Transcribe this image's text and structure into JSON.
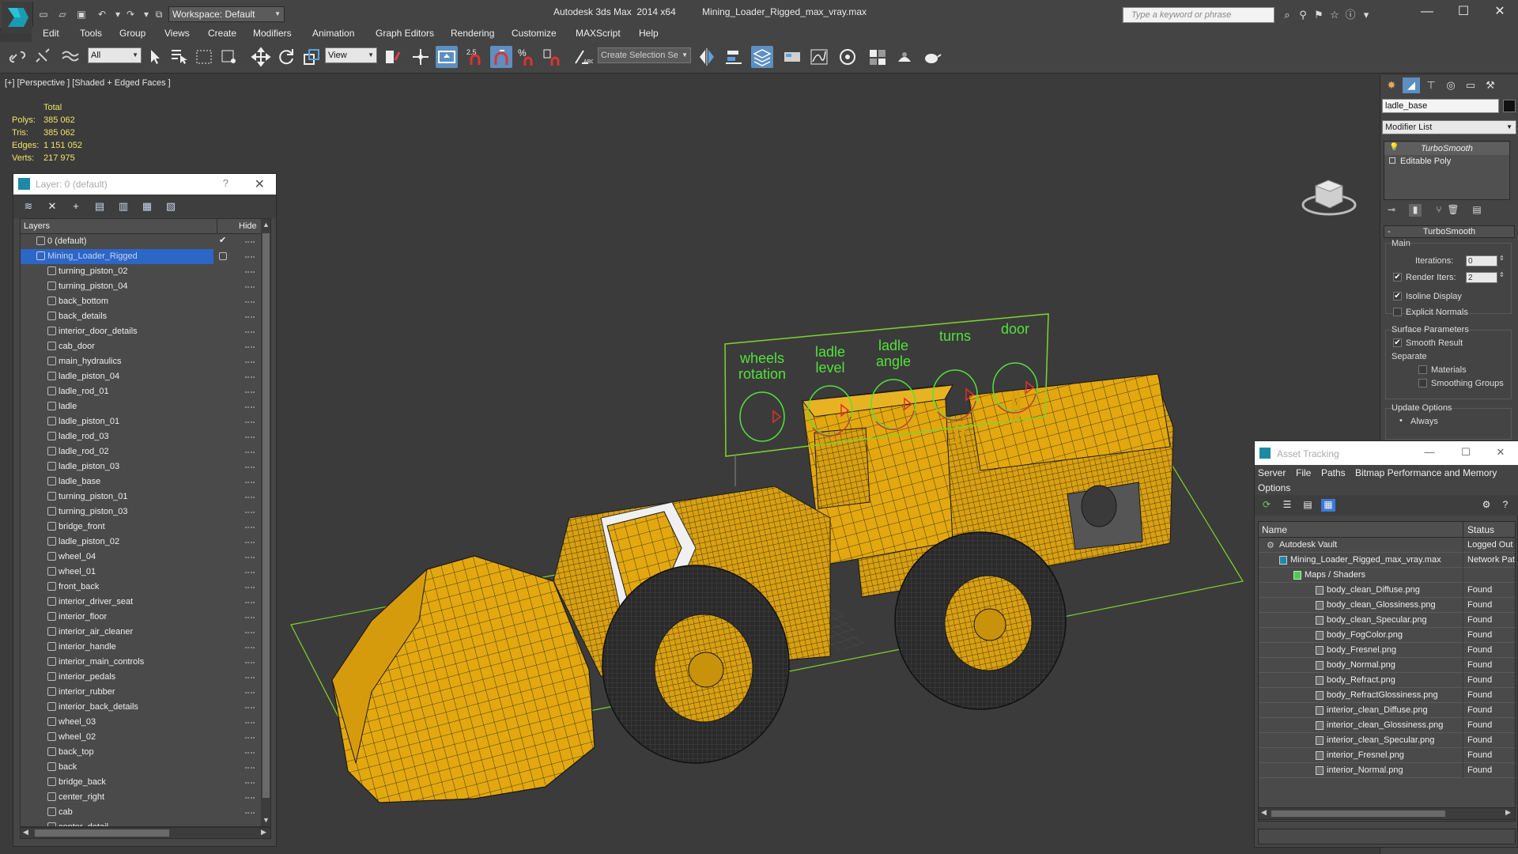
{
  "app": {
    "title": "Autodesk 3ds Max  2014 x64",
    "file": "Mining_Loader_Rigged_max_vray.max",
    "workspace": "Workspace: Default",
    "search_placeholder": "Type a keyword or phrase"
  },
  "menu": [
    "Edit",
    "Tools",
    "Group",
    "Views",
    "Create",
    "Modifiers",
    "Animation",
    "Graph Editors",
    "Rendering",
    "Customize",
    "MAXScript",
    "Help"
  ],
  "toolbar": {
    "filter": "All",
    "ref_coord": "View",
    "snap_label": "2.5",
    "selection_set_placeholder": "Create Selection Se"
  },
  "viewport": {
    "label": "[+] [Perspective ] [Shaded + Edged Faces ]",
    "stats": {
      "header": "Total",
      "polys_label": "Polys:",
      "polys": "385 062",
      "tris_label": "Tris:",
      "tris": "385 062",
      "edges_label": "Edges:",
      "edges": "1 151 052",
      "verts_label": "Verts:",
      "verts": "217 975"
    },
    "control_panel": {
      "labels": [
        {
          "l1": "wheels",
          "l2": "rotation"
        },
        {
          "l1": "ladle",
          "l2": "level"
        },
        {
          "l1": "ladle",
          "l2": "angle"
        },
        {
          "l1": "turns",
          "l2": ""
        },
        {
          "l1": "door",
          "l2": ""
        }
      ]
    },
    "colors": {
      "model": "#e3a80f",
      "wire": "#1a1a1a",
      "selection": "#7ed52a",
      "gizmo_text": "#52e23a",
      "gizmo_arrow": "#e03030"
    }
  },
  "layer_panel": {
    "title": "Layer: 0 (default)",
    "col_layers": "Layers",
    "col_hide": "Hide",
    "default_layer": "0 (default)",
    "selected_layer": "Mining_Loader_Rigged",
    "objects": [
      "turning_piston_02",
      "turning_piston_04",
      "back_bottom",
      "back_details",
      "interior_door_details",
      "cab_door",
      "main_hydraulics",
      "ladle_piston_04",
      "ladle_rod_01",
      "ladle",
      "ladle_piston_01",
      "ladle_rod_03",
      "ladle_rod_02",
      "ladle_piston_03",
      "ladle_base",
      "turning_piston_01",
      "turning_piston_03",
      "bridge_front",
      "ladle_piston_02",
      "wheel_04",
      "wheel_01",
      "front_back",
      "interior_driver_seat",
      "interior_floor",
      "interior_air_cleaner",
      "interior_handle",
      "interior_main_controls",
      "interior_pedals",
      "interior_rubber",
      "interior_back_details",
      "wheel_03",
      "wheel_02",
      "back_top",
      "back",
      "bridge_back",
      "center_right",
      "cab",
      "center_detail"
    ]
  },
  "command_panel": {
    "object_name": "ladle_base",
    "modifier_list": "Modifier List",
    "stack": [
      "TurboSmooth",
      "Editable Poly"
    ],
    "rollout_title": "TurboSmooth",
    "main_label": "Main",
    "iterations_label": "Iterations:",
    "iterations": "0",
    "render_iters_label": "Render Iters:",
    "render_iters": "2",
    "isoline": "Isoline Display",
    "explicit_normals": "Explicit Normals",
    "surface_params": "Surface Parameters",
    "smooth_result": "Smooth Result",
    "separate": "Separate",
    "materials": "Materials",
    "smoothing_groups": "Smoothing Groups",
    "update_options": "Update Options",
    "always": "Always"
  },
  "asset_tracking": {
    "title": "Asset Tracking",
    "menu": [
      "Server",
      "File",
      "Paths",
      "Bitmap Performance and Memory",
      "Options"
    ],
    "col_name": "Name",
    "col_status": "Status",
    "vault": {
      "name": "Autodesk Vault",
      "status": "Logged Out"
    },
    "file": {
      "name": "Mining_Loader_Rigged_max_vray.max",
      "status": "Network Pat"
    },
    "maps": "Maps / Shaders",
    "files": [
      {
        "name": "body_clean_Diffuse.png",
        "status": "Found"
      },
      {
        "name": "body_clean_Glossiness.png",
        "status": "Found"
      },
      {
        "name": "body_clean_Specular.png",
        "status": "Found"
      },
      {
        "name": "body_FogColor.png",
        "status": "Found"
      },
      {
        "name": "body_Fresnel.png",
        "status": "Found"
      },
      {
        "name": "body_Normal.png",
        "status": "Found"
      },
      {
        "name": "body_Refract.png",
        "status": "Found"
      },
      {
        "name": "body_RefractGlossiness.png",
        "status": "Found"
      },
      {
        "name": "interior_clean_Diffuse.png",
        "status": "Found"
      },
      {
        "name": "interior_clean_Glossiness.png",
        "status": "Found"
      },
      {
        "name": "interior_clean_Specular.png",
        "status": "Found"
      },
      {
        "name": "interior_Fresnel.png",
        "status": "Found"
      },
      {
        "name": "interior_Normal.png",
        "status": "Found"
      }
    ]
  }
}
